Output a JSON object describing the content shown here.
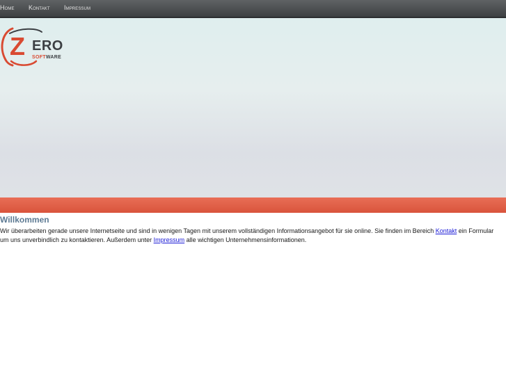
{
  "nav": {
    "items": [
      {
        "label": "Home"
      },
      {
        "label": "Kontakt"
      },
      {
        "label": "Impressum"
      }
    ]
  },
  "logo": {
    "word": "ERO",
    "letter": "Z",
    "sub_accent": "SOFT",
    "sub_rest": "WARE"
  },
  "colors": {
    "accent": "#d9543c",
    "heading": "#5d7a93",
    "nav_bg": "#4a4d50"
  },
  "main": {
    "heading": "Willkommen",
    "text_part1": "Wir überarbeiten gerade unsere Internetseite und sind in wenigen Tagen mit unserem vollständigen Informationsangebot für sie online. Sie finden im Bereich ",
    "link_kontakt": "Kontakt",
    "text_part2": " ein Formular um uns unverbindlich zu kontaktieren. Außerdem unter ",
    "link_impressum": "Impressum",
    "text_part3": " alle wichtigen Unternehmensinformationen."
  }
}
